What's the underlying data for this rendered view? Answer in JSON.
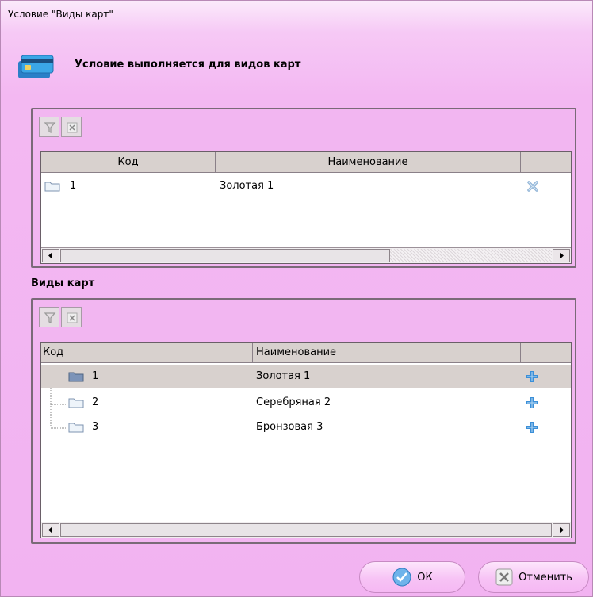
{
  "window": {
    "title": "Условие \"Виды карт\""
  },
  "header": {
    "text": "Условие выполняется для видов карт",
    "icon": "credit-card-icon"
  },
  "selected_grid": {
    "toolbar": {
      "filter_icon": "filter-icon",
      "clear_icon": "clear-filter-icon"
    },
    "columns": [
      "Код",
      "Наименование",
      ""
    ],
    "rows": [
      {
        "code": "1",
        "name": "Золотая 1",
        "action_icon": "remove-icon"
      }
    ]
  },
  "catalog": {
    "label": "Виды карт",
    "toolbar": {
      "filter_icon": "filter-icon",
      "clear_icon": "clear-filter-icon"
    },
    "columns": [
      "Код",
      "Наименование",
      ""
    ],
    "rows": [
      {
        "code": "1",
        "name": "Золотая 1",
        "action_icon": "add-icon",
        "selected": true
      },
      {
        "code": "2",
        "name": "Серебряная 2",
        "action_icon": "add-icon",
        "selected": false
      },
      {
        "code": "3",
        "name": "Бронзовая 3",
        "action_icon": "add-icon",
        "selected": false
      }
    ]
  },
  "buttons": {
    "ok_label": "ОК",
    "cancel_label": "Отменить"
  },
  "colors": {
    "window_bg": "#f3b8f2",
    "selected_row": "#d8d1ce",
    "add_icon": "#3b8fd8"
  }
}
